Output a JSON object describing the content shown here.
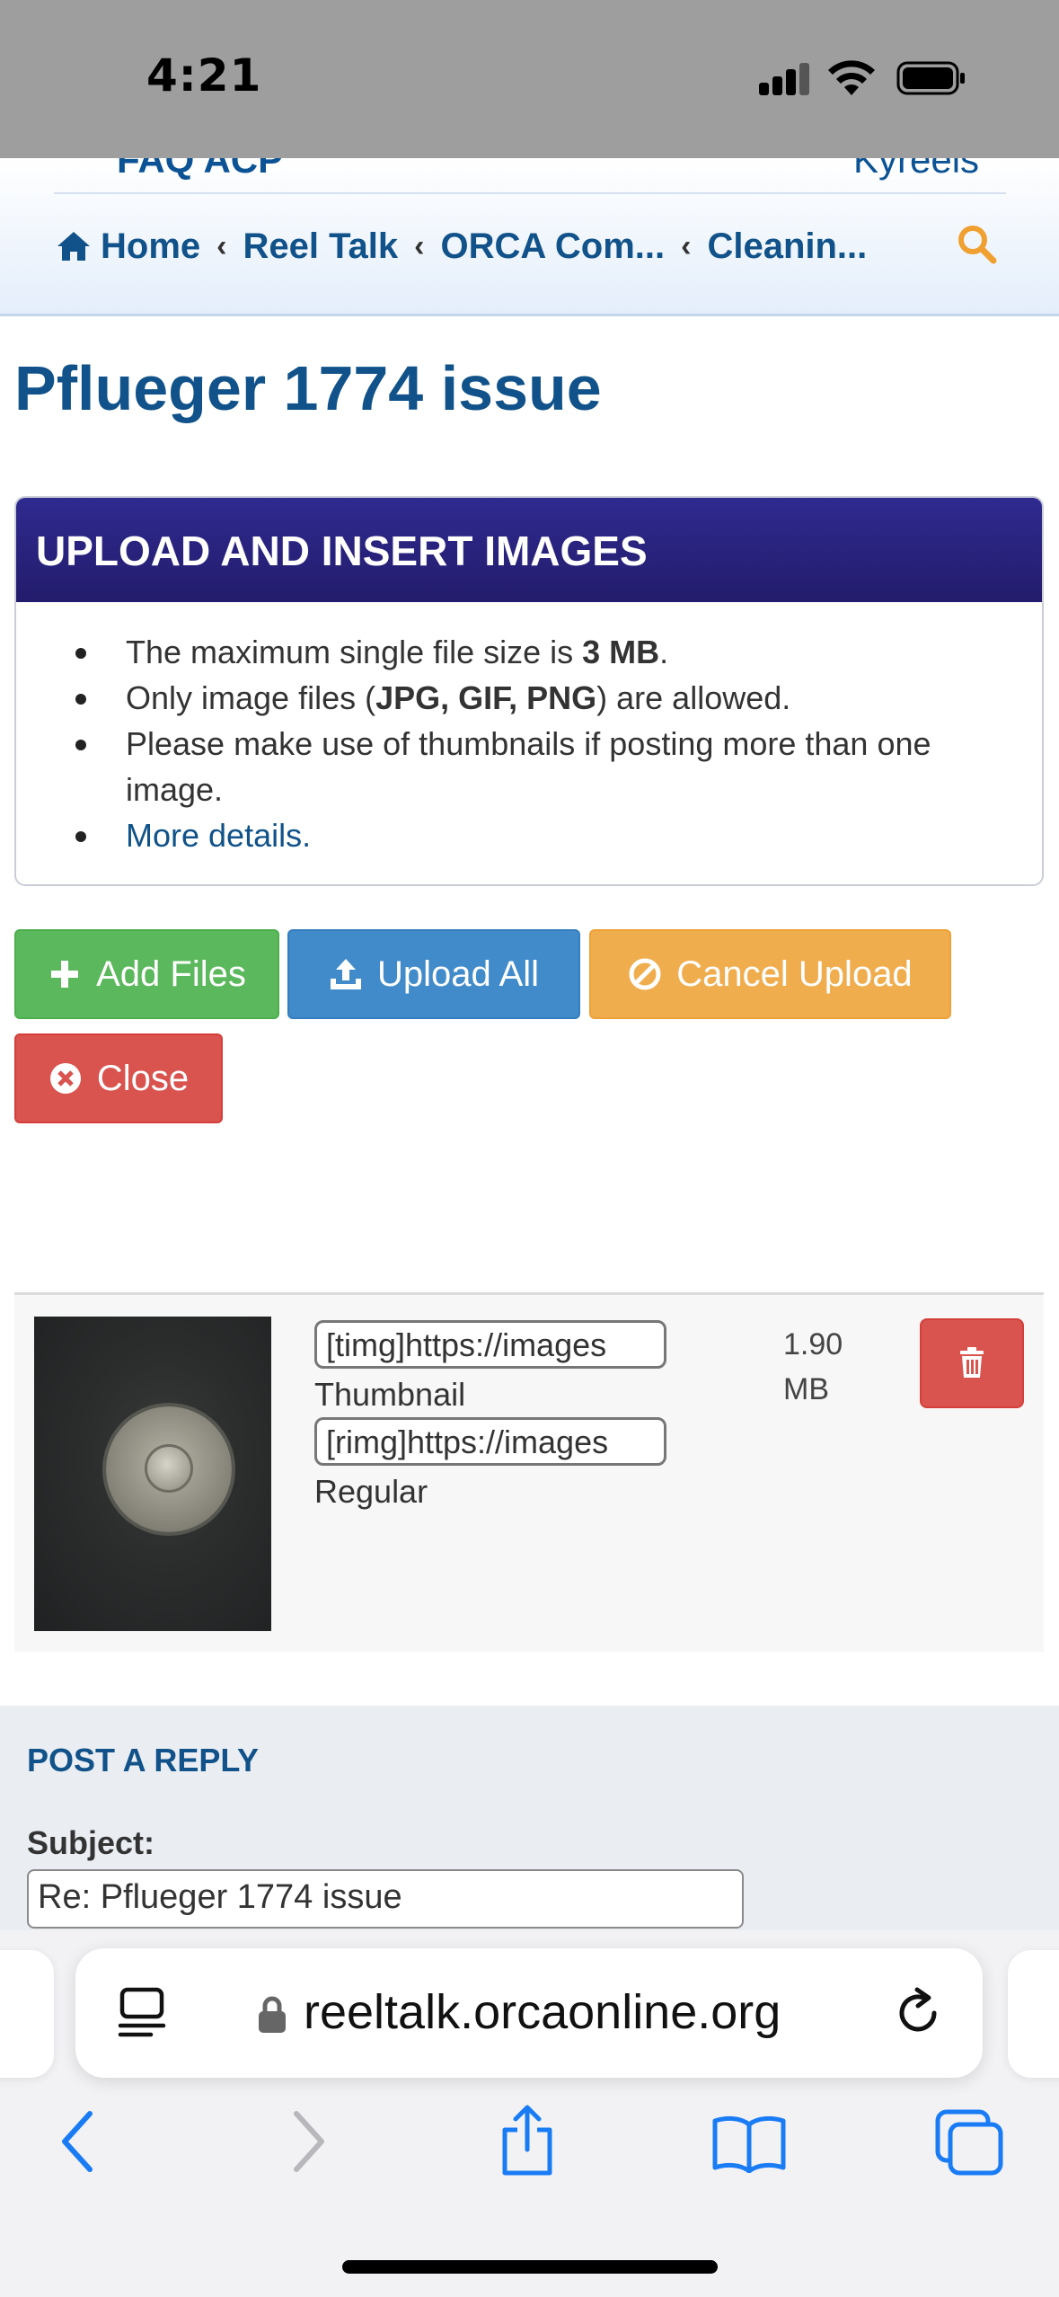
{
  "status_bar": {
    "time": "4:21"
  },
  "header": {
    "top_peek_left": "FAQ  ACP",
    "top_peek_right": "Kyreels",
    "breadcrumb": [
      "Home",
      "Reel Talk",
      "ORCA Com...",
      "Cleanin..."
    ]
  },
  "page": {
    "title": "Pflueger 1774 issue"
  },
  "upload": {
    "header": "UPLOAD AND INSERT IMAGES",
    "rule1_prefix": "The maximum single file size is ",
    "rule1_bold": "3 MB",
    "rule1_suffix": ".",
    "rule2_prefix": "Only image files (",
    "rule2_bold": "JPG, GIF, PNG",
    "rule2_suffix": ") are allowed.",
    "rule3_line1": "Please make use of thumbnails if posting more than one",
    "rule3_line2": "image.",
    "more_details": "More details."
  },
  "buttons": {
    "add_files": "Add Files",
    "upload_all": "Upload All",
    "cancel_upload": "Cancel Upload",
    "close": "Close"
  },
  "file": {
    "thumbnail_code": "[timg]https://images",
    "thumbnail_label": "Thumbnail",
    "regular_code": "[rimg]https://images",
    "regular_label": "Regular",
    "size_value": "1.90",
    "size_unit": "MB"
  },
  "reply": {
    "title": "POST A REPLY",
    "subject_label": "Subject:",
    "subject_value": "Re: Pflueger 1774 issue"
  },
  "browser": {
    "url": "reeltalk.orcaonline.org"
  },
  "colors": {
    "brand_blue": "#105289",
    "panel_header": "#2f2a8f",
    "add_green": "#5cb85c",
    "upload_blue": "#428bca",
    "cancel_orange": "#f0ad4e",
    "close_red": "#d9534f",
    "search_orange": "#f0a030",
    "safari_blue": "#1a7cf5"
  }
}
